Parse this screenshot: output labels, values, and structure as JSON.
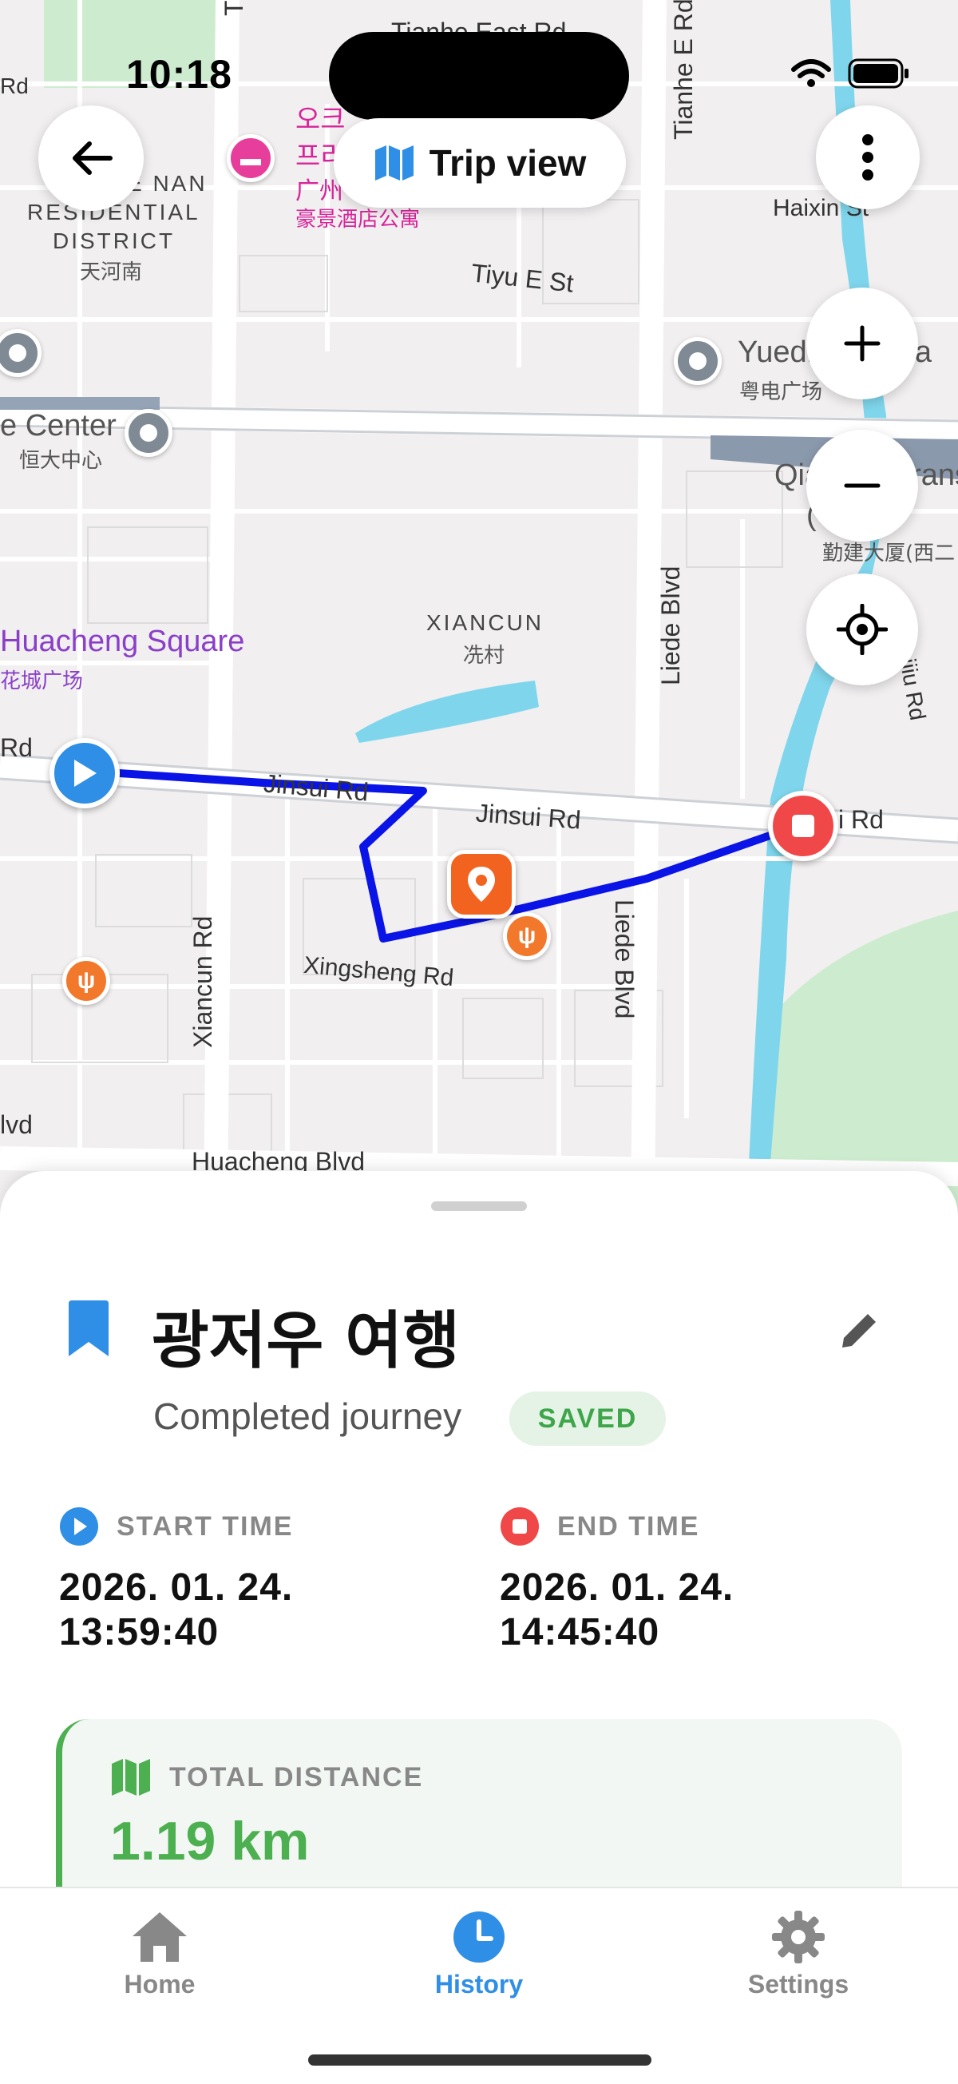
{
  "status_bar": {
    "time": "10:18"
  },
  "map": {
    "trip_view_label": "Trip view",
    "district": {
      "line1": "TIANHE NAN",
      "line2": "RESIDENTIAL",
      "line3": "DISTRICT",
      "cn": "天河南"
    },
    "labels": {
      "tiyu_e_vertical": "Tiyu E Rd",
      "tianhe_east": "Tianhe East Rd",
      "tianhe_e_vertical": "Tianhe E Rd",
      "rd_top_left": "Rd",
      "haixin": "Haixin St",
      "tiyu_e_st": "Tiyu E St",
      "yuedian": "Yuedian Plaza",
      "yuedian_cn": "粤电广场",
      "center": "e Center",
      "center_cn": "恒大中心",
      "qiaojian": "Qiaojian Trans",
      "gate": "( Gate",
      "qiaojian_cn": "勤建大厦(西二",
      "xiancun": "XIANCUN",
      "xiancun_cn": "冼村",
      "huacheng_sq": "Huacheng Square",
      "huacheng_sq_cn": "花城广场",
      "rd_left": "Rd",
      "jinsui_1": "Jinsui Rd",
      "jinsui_2": "Jinsui Rd",
      "jinsui_3": "i Rd",
      "liede_1": "Liede Blvd",
      "liede_2": "Liede Blvd",
      "xiancun_rd": "Xiancun Rd",
      "xingsheng": "Xingsheng Rd",
      "huacheng_blvd": "Huacheng Blvd",
      "blvd_left": "lvd",
      "ijiu_rd": "ijiu Rd",
      "hotel_ko1": "오크",
      "hotel_ko2": "프리",
      "hotel_cn1": "广州",
      "hotel_cn2": "豪景酒店公寓"
    }
  },
  "trip": {
    "title": "광저우 여행",
    "subtitle": "Completed journey",
    "badge": "SAVED",
    "start_label": "START TIME",
    "start_date": "2026. 01. 24.",
    "start_time": "13:59:40",
    "end_label": "END TIME",
    "end_date": "2026. 01. 24.",
    "end_time": "14:45:40",
    "distance_label": "TOTAL DISTANCE",
    "distance_value": "1.19 km"
  },
  "tabs": [
    {
      "label": "Home"
    },
    {
      "label": "History"
    },
    {
      "label": "Settings"
    }
  ],
  "colors": {
    "route": "#0a14e6",
    "accent_blue": "#2f8ee5",
    "stop_red": "#f04848",
    "saved_green": "#4caf50",
    "water": "#7fd6ec",
    "park": "#cdeccf"
  }
}
